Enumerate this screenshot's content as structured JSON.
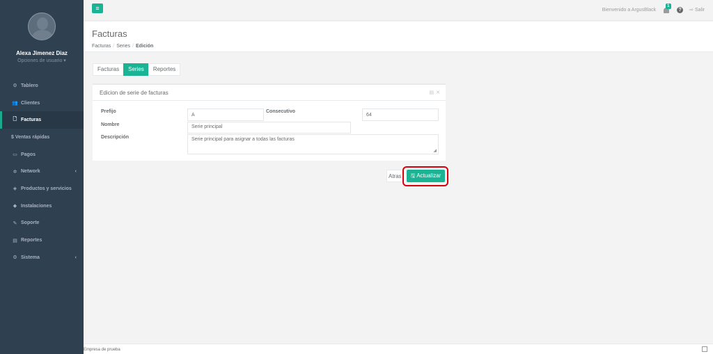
{
  "sidebar": {
    "user_name": "Alexa Jimenez Diaz",
    "user_options": "Opciones de usuario ▾",
    "items": [
      {
        "label": "Tablero",
        "icon": "dashboard-icon",
        "glyph": "⚙"
      },
      {
        "label": "Clientes",
        "icon": "users-icon",
        "glyph": "👥"
      },
      {
        "label": "Facturas",
        "icon": "document-icon",
        "glyph": "🗋"
      },
      {
        "label": "$ Ventas rápidas",
        "icon": "",
        "glyph": ""
      },
      {
        "label": "Pagos",
        "icon": "money-icon",
        "glyph": "▭"
      },
      {
        "label": "Network",
        "icon": "network-icon",
        "glyph": "✲"
      },
      {
        "label": "Productos y servicios",
        "icon": "tag-icon",
        "glyph": "◈"
      },
      {
        "label": "Instalaciones",
        "icon": "plug-icon",
        "glyph": "◆"
      },
      {
        "label": "Soporte",
        "icon": "wrench-icon",
        "glyph": "✎"
      },
      {
        "label": "Reportes",
        "icon": "database-icon",
        "glyph": "▤"
      },
      {
        "label": "Sistema",
        "icon": "cogs-icon",
        "glyph": "⚙"
      }
    ]
  },
  "topbar": {
    "menu_glyph": "≡",
    "welcome": "Bienvenido a ArgusBlack",
    "notifications_count": "1",
    "help_glyph": "?",
    "logout": "⇨ Salir"
  },
  "heading": {
    "title": "Facturas",
    "crumb1": "Facturas",
    "crumb2": "Series",
    "crumb3": "Edición",
    "sep": "/"
  },
  "tabs": [
    "Facturas",
    "Series",
    "Reportes"
  ],
  "panel": {
    "title": "Edicion de serie de facturas",
    "prefijo_label": "Prefijo",
    "prefijo_value": "A",
    "consecutivo_label": "Consecutivo",
    "consecutivo_value": "64",
    "nombre_label": "Nombre",
    "nombre_value": "Serie principal",
    "descripcion_label": "Descripción",
    "descripcion_value": "Serie principal para asignar a todas las facturas"
  },
  "actions": {
    "back": "Atras",
    "update": "🖫 Actualizar"
  },
  "footer": {
    "company": "Empresa de prueba"
  },
  "colors": {
    "sidebar": "#2f4050",
    "accent": "#1ab394",
    "highlight": "#d9000d"
  }
}
